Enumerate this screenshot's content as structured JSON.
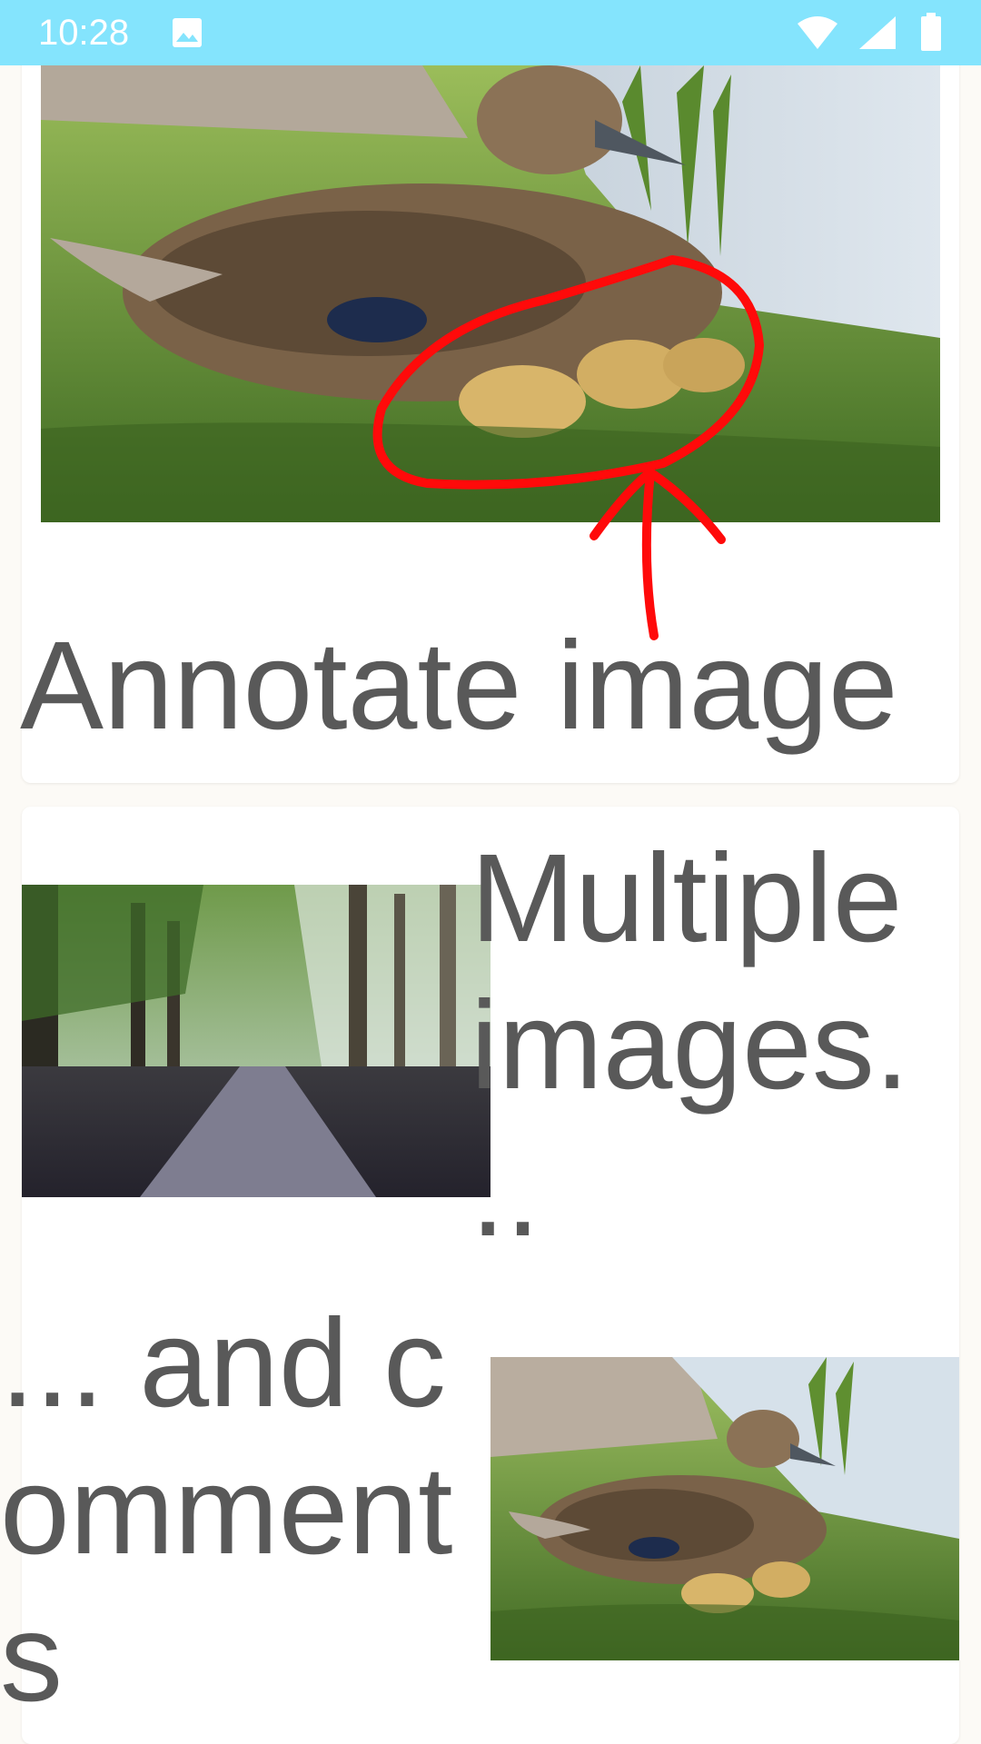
{
  "status_bar": {
    "time": "10:28",
    "icons": [
      "image-notification-icon",
      "wifi-icon",
      "cellular-signal-icon",
      "battery-icon"
    ],
    "background": "#84e4fd"
  },
  "cards": {
    "annotate": {
      "title": "Annotate image"
    },
    "multiple": {
      "text": "Multiple images. ..",
      "comment_text": "... and comments"
    }
  },
  "colors": {
    "text": "#595959",
    "annotation_stroke": "#ff0a0a",
    "card_bg": "#ffffff",
    "page_bg": "#fcfaf6"
  }
}
